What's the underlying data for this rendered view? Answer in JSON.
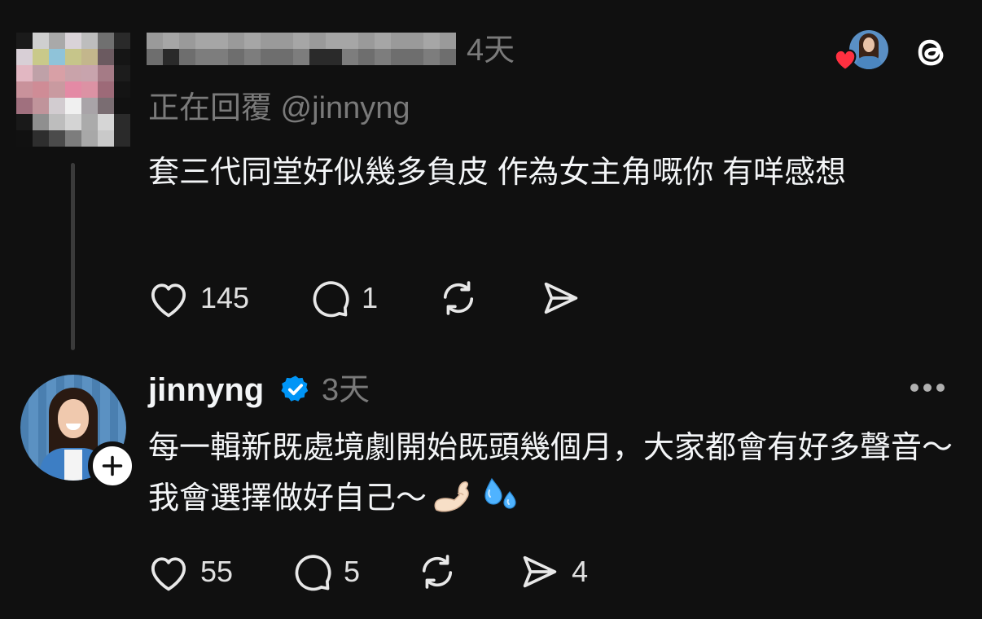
{
  "post1": {
    "time": "4天",
    "replying_to": "正在回覆 @jinnyng",
    "text": "套三代同堂好似幾多負皮 作為女主角嘅你 有咩感想",
    "likes": "145",
    "replies": "1",
    "avatar_colors": [
      [
        "#1a1a1a",
        "#cfcfcf",
        "#a9a9a9",
        "#d9d3d8",
        "#bdbdbd",
        "#707070",
        "#2a2a2a"
      ],
      [
        "#d8cfd6",
        "#c9c98a",
        "#8fc3d9",
        "#c6c58a",
        "#c3b68c",
        "#6b5a60",
        "#151515"
      ],
      [
        "#e2b7c2",
        "#bfa1a8",
        "#d8a0a6",
        "#c9a3aa",
        "#c8a4ad",
        "#a57b86",
        "#1c1c1c"
      ],
      [
        "#c9929b",
        "#cf8c96",
        "#c99aa0",
        "#e48aa5",
        "#dc92a4",
        "#9d6a78",
        "#141414"
      ],
      [
        "#a0707e",
        "#c0949b",
        "#d2ccd0",
        "#f0f0f0",
        "#a9a4a8",
        "#7a6d72",
        "#111111"
      ],
      [
        "#191919",
        "#8f8f8f",
        "#bdbdbd",
        "#d4d4d4",
        "#ababab",
        "#d6d6d6",
        "#2b2b2b"
      ],
      [
        "#111111",
        "#2e2e2e",
        "#4b4b4b",
        "#7d7d7d",
        "#a8a8a8",
        "#c9c9c9",
        "#2a2a2a"
      ]
    ]
  },
  "top_right": {
    "liker_icon": "liked-by-avatar",
    "heart_color": "#ff3040",
    "logo_icon": "threads-logo-icon"
  },
  "post2": {
    "username": "jinnyng",
    "verified_color": "#0095f6",
    "time": "3天",
    "text": "每一輯新既處境劇開始既頭幾個月，大家都會有好多聲音～ 我會選擇做好自己～",
    "emojis": [
      "flexed-biceps-icon",
      "sweat-droplets-icon"
    ],
    "likes": "55",
    "replies": "5",
    "shares": "4"
  }
}
